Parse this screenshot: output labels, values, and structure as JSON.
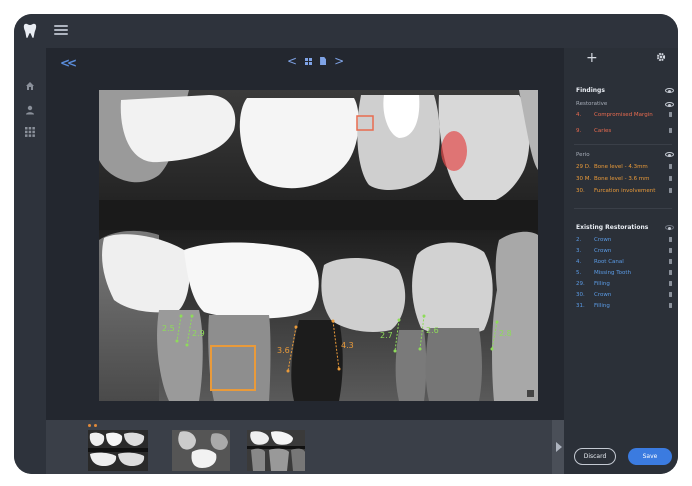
{
  "colors": {
    "accent_blue": "#3b7be0",
    "finding_red": "#e96b4f",
    "finding_orange": "#e99a3a",
    "restoration_blue": "#5b9be6",
    "measure_green": "#8edb5a"
  },
  "nav": {
    "collapse_label": "<<",
    "prev_label": "<",
    "next_label": ">"
  },
  "panel": {
    "add_icon": "+",
    "settings_icon": "gear-icon",
    "findings_title": "Findings",
    "restorative_label": "Restorative",
    "restorative_items": [
      {
        "num": "4.",
        "text": "Compromised Margin"
      },
      {
        "num": "9.",
        "text": "Caries"
      }
    ],
    "perio_label": "Perio",
    "perio_items": [
      {
        "num": "29 D.",
        "text": "Bone level - 4.3mm"
      },
      {
        "num": "30 M.",
        "text": "Bone level - 3.6 mm"
      },
      {
        "num": "30.",
        "text": "Furcation involvement"
      }
    ],
    "existing_title": "Existing Restorations",
    "existing_items": [
      {
        "num": "2.",
        "text": "Crown"
      },
      {
        "num": "3.",
        "text": "Crown"
      },
      {
        "num": "4.",
        "text": "Root Canal"
      },
      {
        "num": "5.",
        "text": "Missing Tooth"
      },
      {
        "num": "29.",
        "text": "Filling"
      },
      {
        "num": "30.",
        "text": "Crown"
      },
      {
        "num": "31.",
        "text": "Filling"
      }
    ],
    "discard_label": "Discard",
    "save_label": "Save"
  },
  "measurements": [
    "2.5",
    "2.9",
    "3.6",
    "4.3",
    "2.7",
    "2.6",
    "2.8"
  ]
}
